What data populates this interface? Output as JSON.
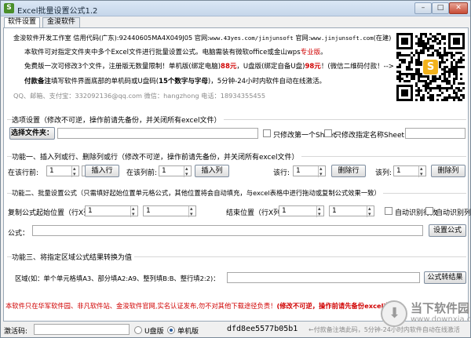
{
  "window": {
    "title": "Excel批量设置公式1.2",
    "app_icon_glyph": "S"
  },
  "tabs": [
    {
      "label": "软件设置",
      "active": true
    },
    {
      "label": "金浚软件",
      "active": false
    }
  ],
  "ad": {
    "line1_part1": "金浚软件开发工作室 信用代码(广东):92440605MA4X049J05 官网:",
    "line1_url1": "www.43yes.com/jinjunsoft",
    "line1_mid": " 官网:",
    "line1_url2": "www.jinjunsoft.com",
    "line1_end": "(在建)",
    "line2_part1": "本软件可对指定文件夹中多个Excel文件进行批量设置公式。电脑需装有微软office或金山wps",
    "line2_red": "专业版",
    "line2_end": "。",
    "line3_part1": "免费版一次可修改3个文件，注册版无数量限制！单机版(绑定电脑)",
    "line3_price1": "88元",
    "line3_part2": "，U盘版(绑定自备U盘)",
    "line3_price2": "98元",
    "line3_end": "！(微信二维码付款！-->)",
    "line4_bold1": "付款备注",
    "line4_part1": "填写软件界面底部的单机码或U盘码(",
    "line4_bold2": "15个数字与字母",
    "line4_end": ")，5分钟-24小时内软件自动在线激活。",
    "contact": "QQ、邮箱、支付宝：332092136@qq.com   微信：hangzhong  电话：18934355455",
    "qr_corner_glyph": "S",
    "qr_corner_color": "#f2b21c"
  },
  "settings": {
    "section_label": "选项设置（修改不可逆，操作前请先备份，并关闭所有excel文件）",
    "choose_folder_button": "选择文件夹：",
    "folder_value": "",
    "only_first_sheet_label": "只修改第一个Sheet",
    "only_named_sheet_label": "只修改指定名称Sheet:",
    "sheet_name_value": ""
  },
  "func1": {
    "section_label": "功能一、插入列或行、删除列或行（修改不可逆，操作前请先备份，并关闭所有excel文件）",
    "insert_row_label": "在该行前:",
    "insert_row_value": "1",
    "insert_row_count_value": "1",
    "insert_row_button": "插入行",
    "insert_col_label": "在该列前:",
    "insert_col_value": "1",
    "insert_col_count_value": "1",
    "insert_col_button": "插入列",
    "delete_row_label": "该行:",
    "delete_row_value": "1",
    "delete_row_button": "删除行",
    "delete_col_label": "该列:",
    "delete_col_value": "1",
    "delete_col_button": "删除列"
  },
  "func2": {
    "section_label": "功能二、批量设置公式（只需填好起始位置单元格公式，其他位置将会自动填充，与excel表格中进行拖动或复制公式效果一致）",
    "start_label": "复制公式起始位置（行X列）：",
    "start_row_value": "1",
    "start_col_value": "1",
    "end_label": "结束位置（行X列）：",
    "end_row_value": "1",
    "end_col_value": "1",
    "auto_rows_label": "自动识别行数",
    "auto_cols_label": "自动识别列数",
    "formula_label": "公式：",
    "formula_value": "",
    "set_formula_button": "设置公式"
  },
  "func3": {
    "section_label": "功能三、将指定区域公式结果转换为值",
    "range_label": "区域(如：单个单元格填A3、部分填A2:A9、整列填B:B、整行填2:2)：",
    "range_value": "",
    "convert_button": "公式转结果"
  },
  "warning": {
    "part1": "本软件只在华军软件园、非凡软件站、金浚软件官网,实名认证发布,勿不对其他下载途径负责！",
    "part2": "(修改不可逆，操作前请先备份excel文件)"
  },
  "statusbar": {
    "activation_label": "激活码:",
    "activation_value": "",
    "usb_radio_label": "U盘版",
    "pc_radio_label": "单机版",
    "machine_code": "dfd8ee5577b05b1",
    "hint": "←付款备注填此码，5分钟-24小时内软件自动在线激活"
  },
  "watermark": {
    "title": "当下软件园",
    "url": "www.downxia.com"
  }
}
